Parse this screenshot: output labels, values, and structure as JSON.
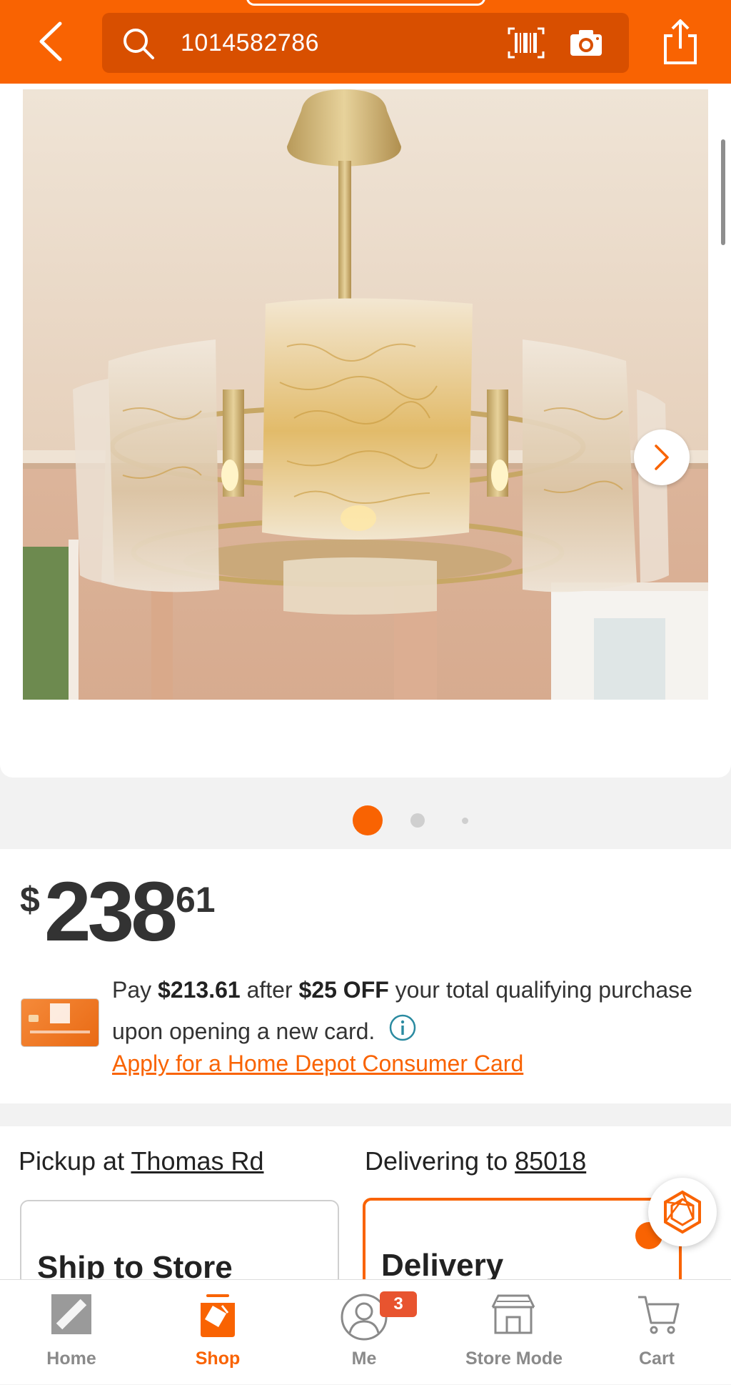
{
  "header": {
    "search_query": "1014582786",
    "icons": [
      "back-icon",
      "search-icon",
      "barcode-icon",
      "camera-icon",
      "share-icon"
    ]
  },
  "gallery": {
    "image_alt": "Gold crystal chandelier ceiling fan",
    "total_dots": 3,
    "active_dot": 1
  },
  "price": {
    "currency": "$",
    "dollars": "238",
    "cents": "61"
  },
  "offer": {
    "text_pay": "Pay",
    "amount": "$213.61",
    "text_after": "after",
    "discount": "$25 OFF",
    "text_rest": "your total qualifying purchase upon opening a new card.",
    "apply_link": "Apply for a Home Depot Consumer Card"
  },
  "fulfillment": {
    "pickup_prefix": "Pickup at",
    "pickup_store": "Thomas Rd",
    "delivery_prefix": "Delivering to",
    "delivery_zip": "85018",
    "ship_to_store_label": "Ship to Store",
    "delivery_label": "Delivery"
  },
  "bottom_nav": {
    "items": [
      {
        "label": "Home"
      },
      {
        "label": "Shop"
      },
      {
        "label": "Me"
      },
      {
        "label": "Store Mode"
      },
      {
        "label": "Cart"
      }
    ],
    "me_badge": "3",
    "active": "Shop"
  },
  "colors": {
    "brand_orange": "#f96302",
    "text_dark": "#222222"
  }
}
